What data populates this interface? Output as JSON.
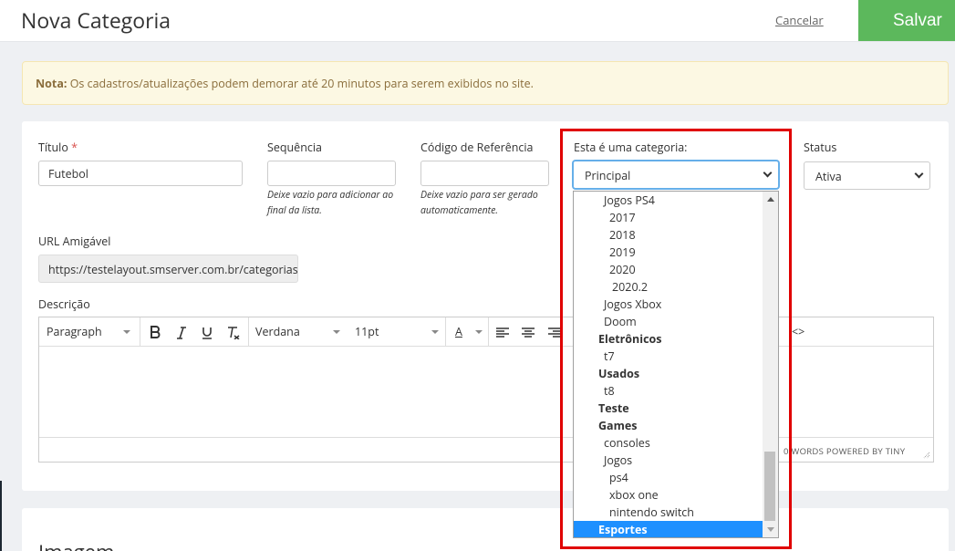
{
  "header": {
    "title": "Nova Categoria",
    "cancel_label": "Cancelar",
    "save_label": "Salvar"
  },
  "note": {
    "label": "Nota:",
    "text": " Os cadastros/atualizações podem demorar até 20 minutos para serem exibidos no site."
  },
  "form": {
    "titulo": {
      "label": "Título",
      "required_mark": "*",
      "value": "Futebol"
    },
    "sequencia": {
      "label": "Sequência",
      "value": "",
      "help": "Deixe vazio para adicionar ao final da lista."
    },
    "codigo": {
      "label": "Código de Referência",
      "value": "",
      "help": "Deixe vazio para ser gerado automaticamente."
    },
    "parent": {
      "label": "Esta é uma categoria:",
      "value": "Principal"
    },
    "status": {
      "label": "Status",
      "value": "Ativa"
    },
    "url": {
      "label": "URL Amigável",
      "value": "https://testelayout.smserver.com.br/categorias/"
    },
    "descricao": {
      "label": "Descrição"
    }
  },
  "editor": {
    "block_format": "Paragraph",
    "font_family": "Verdana",
    "font_size": "11pt",
    "color_letter": "A",
    "code_label": "<>",
    "statusbar": "0 WORDS POWERED BY TINY"
  },
  "dropdown": {
    "options": [
      {
        "label": "Jogos PS4",
        "level": 1,
        "group": false
      },
      {
        "label": "2017",
        "level": 2,
        "group": false
      },
      {
        "label": "2018",
        "level": 2,
        "group": false
      },
      {
        "label": "2019",
        "level": 2,
        "group": false
      },
      {
        "label": "2020",
        "level": 2,
        "group": false
      },
      {
        "label": "2020.2",
        "level": 3,
        "group": false
      },
      {
        "label": "Jogos Xbox",
        "level": 1,
        "group": false
      },
      {
        "label": "Doom",
        "level": 1,
        "group": false
      },
      {
        "label": "Eletrônicos",
        "level": 0,
        "group": true
      },
      {
        "label": "t7",
        "level": 1,
        "group": false
      },
      {
        "label": "Usados",
        "level": 0,
        "group": true
      },
      {
        "label": "t8",
        "level": 1,
        "group": false
      },
      {
        "label": "Teste",
        "level": 0,
        "group": true
      },
      {
        "label": "Games",
        "level": 0,
        "group": true
      },
      {
        "label": "consoles",
        "level": 1,
        "group": false
      },
      {
        "label": "Jogos",
        "level": 1,
        "group": false
      },
      {
        "label": "ps4",
        "level": 2,
        "group": false
      },
      {
        "label": "xbox one",
        "level": 2,
        "group": false
      },
      {
        "label": "nintendo switch",
        "level": 2,
        "group": false
      },
      {
        "label": "Esportes",
        "level": 0,
        "group": true,
        "selected": true
      }
    ]
  },
  "section2": {
    "title": "Imagem"
  },
  "colors": {
    "save": "#5cb85c",
    "highlight": "#e00000",
    "selection": "#1e90ff",
    "note_bg": "#fcf8e3"
  }
}
